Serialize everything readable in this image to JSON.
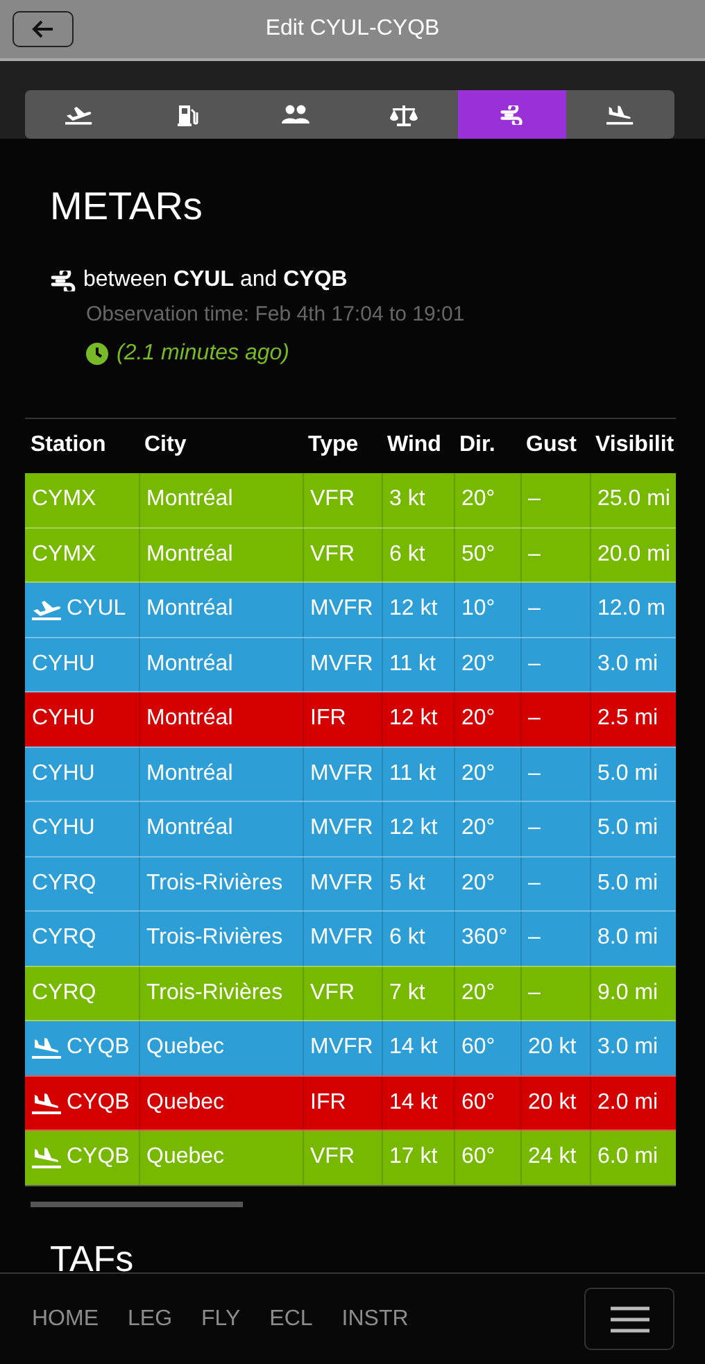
{
  "header": {
    "title": "Edit CYUL-CYQB"
  },
  "tabs": [
    {
      "kind": "departure",
      "selected": false
    },
    {
      "kind": "fuel",
      "selected": false
    },
    {
      "kind": "passengers",
      "selected": false
    },
    {
      "kind": "balance",
      "selected": false
    },
    {
      "kind": "wind",
      "selected": true
    },
    {
      "kind": "arrival",
      "selected": false
    }
  ],
  "metars": {
    "title": "METARs",
    "summary": "between **CYUL** and **CYQB**",
    "observation": "Observation time: Feb 4th 17:04 to 19:01",
    "age": "(2.1 minutes ago)"
  },
  "table": {
    "columns": [
      "Station",
      "City",
      "Type",
      "Wind",
      "Dir.",
      "Gust",
      "Visibilit"
    ],
    "rows": [
      {
        "color": "#76b900",
        "cells": [
          "CYMX",
          "Montréal",
          "VFR",
          "3 kt",
          "20°",
          "–",
          "25.0 mi"
        ]
      },
      {
        "color": "#76b900",
        "cells": [
          "CYMX",
          "Montréal",
          "VFR",
          "6 kt",
          "50°",
          "–",
          "20.0 mi"
        ]
      },
      {
        "color": "#2e9fd6",
        "kind": "departure",
        "cells": [
          "CYUL",
          "Montréal",
          "MVFR",
          "12 kt",
          "10°",
          "–",
          "12.0 m"
        ]
      },
      {
        "color": "#2e9fd6",
        "cells": [
          "CYHU",
          "Montréal",
          "MVFR",
          "11 kt",
          "20°",
          "–",
          "3.0 mi"
        ]
      },
      {
        "color": "#d40000",
        "cells": [
          "CYHU",
          "Montréal",
          "IFR",
          "12 kt",
          "20°",
          "–",
          "2.5 mi"
        ]
      },
      {
        "color": "#2e9fd6",
        "cells": [
          "CYHU",
          "Montréal",
          "MVFR",
          "11 kt",
          "20°",
          "–",
          "5.0 mi"
        ]
      },
      {
        "color": "#2e9fd6",
        "cells": [
          "CYHU",
          "Montréal",
          "MVFR",
          "12 kt",
          "20°",
          "–",
          "5.0 mi"
        ]
      },
      {
        "color": "#2e9fd6",
        "cells": [
          "CYRQ",
          "Trois-Rivières",
          "MVFR",
          "5 kt",
          "20°",
          "–",
          "5.0 mi"
        ]
      },
      {
        "color": "#2e9fd6",
        "cells": [
          "CYRQ",
          "Trois-Rivières",
          "MVFR",
          "6 kt",
          "360°",
          "–",
          "8.0 mi"
        ]
      },
      {
        "color": "#76b900",
        "cells": [
          "CYRQ",
          "Trois-Rivières",
          "VFR",
          "7 kt",
          "20°",
          "–",
          "9.0 mi"
        ]
      },
      {
        "color": "#2e9fd6",
        "kind": "arrival",
        "cells": [
          "CYQB",
          "Quebec",
          "MVFR",
          "14 kt",
          "60°",
          "20 kt",
          "3.0 mi"
        ]
      },
      {
        "color": "#d40000",
        "kind": "arrival",
        "cells": [
          "CYQB",
          "Quebec",
          "IFR",
          "14 kt",
          "60°",
          "20 kt",
          "2.0 mi"
        ]
      },
      {
        "color": "#76b900",
        "kind": "arrival",
        "cells": [
          "CYQB",
          "Quebec",
          "VFR",
          "17 kt",
          "60°",
          "24 kt",
          "6.0 mi"
        ]
      }
    ]
  },
  "tafs": {
    "title": "TAFs"
  },
  "footer": {
    "links": [
      "HOME",
      "LEG",
      "FLY",
      "ECL",
      "INSTR"
    ]
  }
}
